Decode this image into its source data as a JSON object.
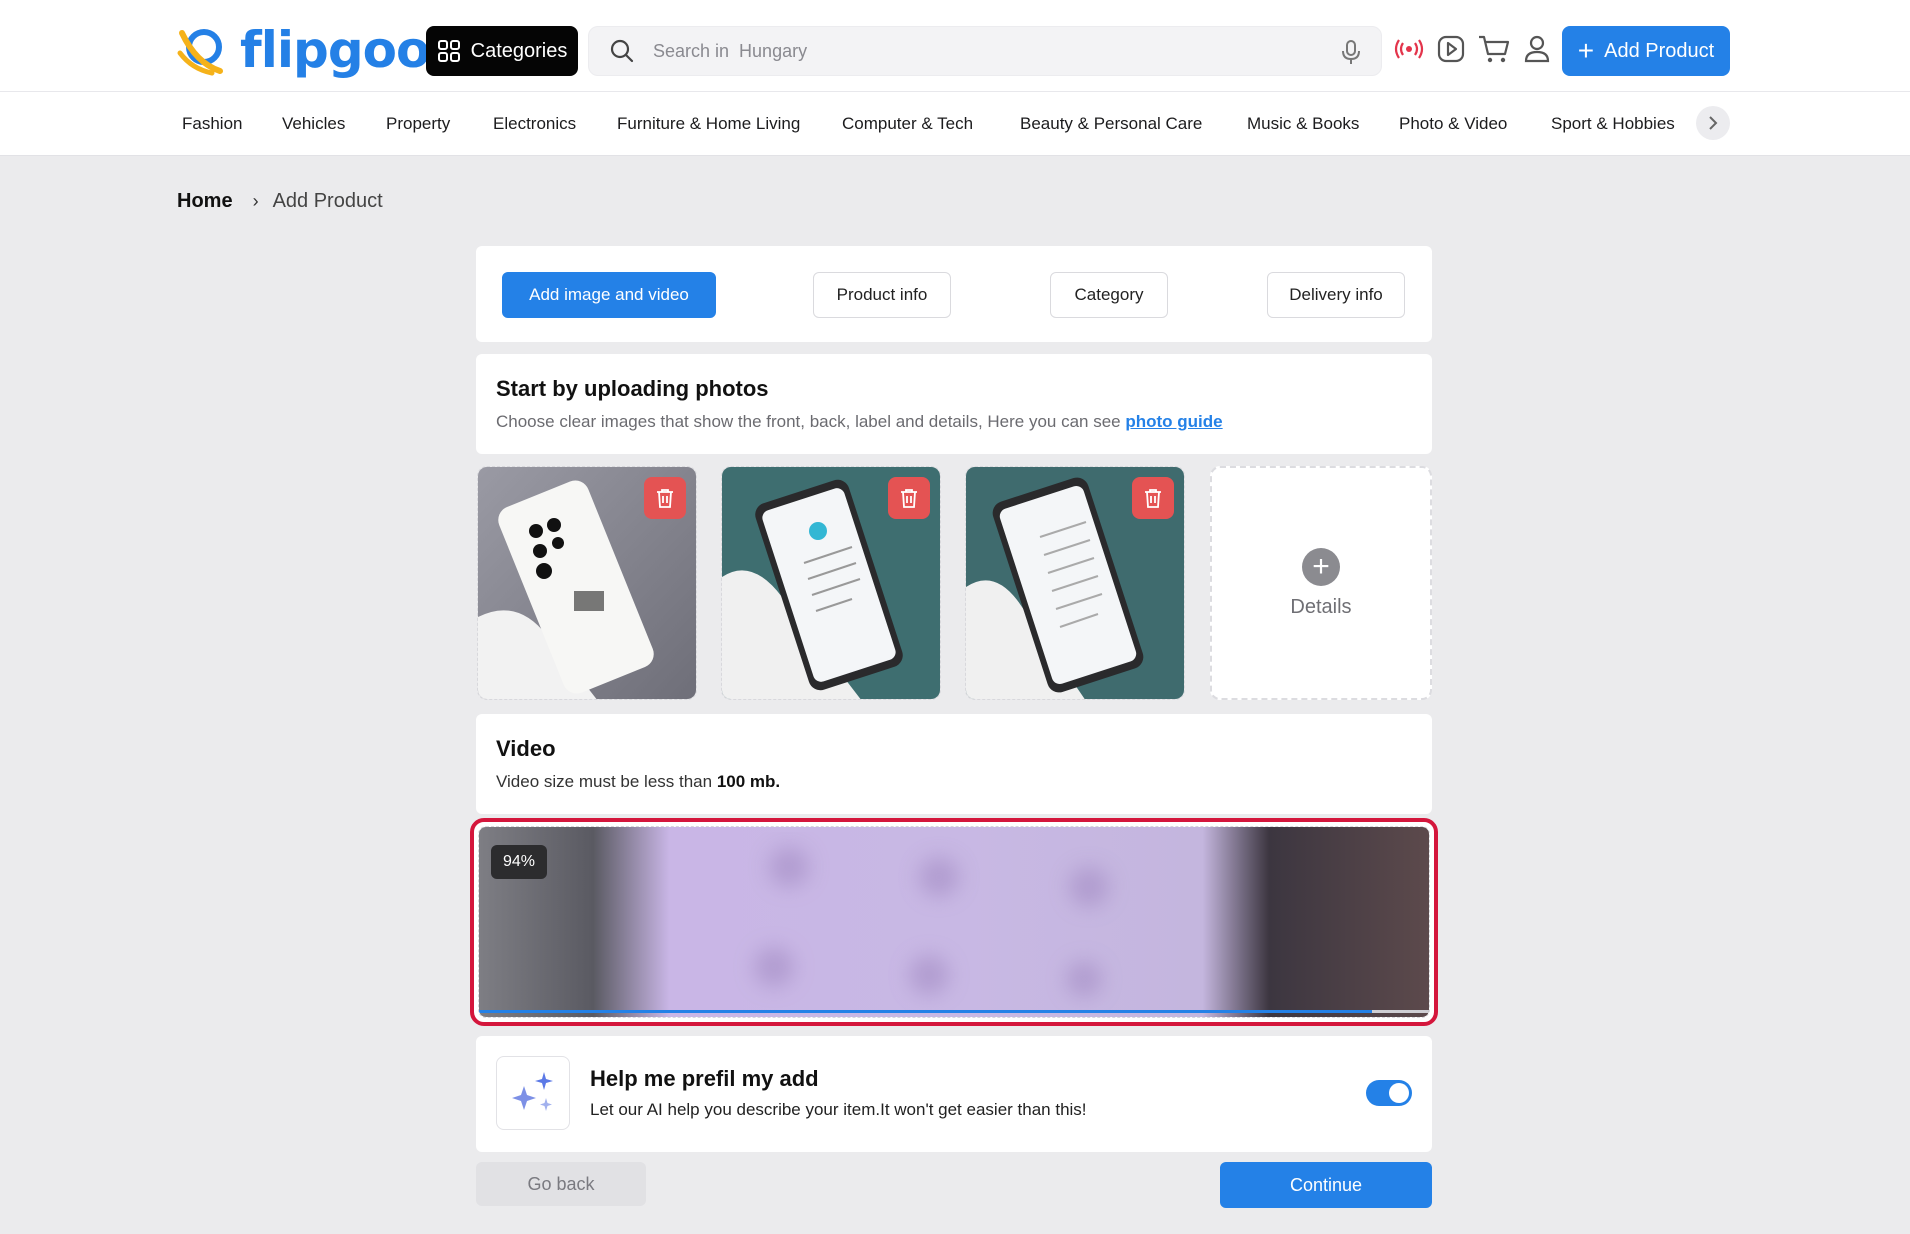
{
  "header": {
    "logo_text": "flipgoo",
    "categories_label": "Categories",
    "search_placeholder": "Search in  Hungary",
    "add_product_label": "Add Product",
    "icons": [
      "live-broadcast-icon",
      "play-video-icon",
      "cart-icon",
      "user-icon"
    ]
  },
  "nav": {
    "items": [
      "Fashion",
      "Vehicles",
      "Property",
      "Electronics",
      "Furniture & Home Living",
      "Computer & Tech",
      "Beauty & Personal Care",
      "Music & Books",
      "Photo & Video",
      "Sport & Hobbies"
    ]
  },
  "breadcrumb": {
    "home": "Home",
    "current": "Add Product"
  },
  "steps": [
    "Add image and video",
    "Product info",
    "Category",
    "Delivery info"
  ],
  "upload": {
    "title": "Start by uploading photos",
    "subtitle": "Choose clear images that show the front, back, label and details, Here you can see ",
    "guide_link": "photo guide",
    "details_label": "Details"
  },
  "video": {
    "title": "Video",
    "subtitle_prefix": "Video size must be less than ",
    "subtitle_bold": "100 mb.",
    "progress_label": "94%",
    "progress_value": 0.94
  },
  "ai": {
    "title": "Help me prefil my add",
    "subtitle": "Let our AI help you describe your item.It won't get easier than this!",
    "enabled": true
  },
  "actions": {
    "back_label": "Go back",
    "continue_label": "Continue"
  },
  "colors": {
    "accent": "#2481e7",
    "danger": "#e45353",
    "highlight": "#d4163c",
    "live": "#e3344b"
  }
}
